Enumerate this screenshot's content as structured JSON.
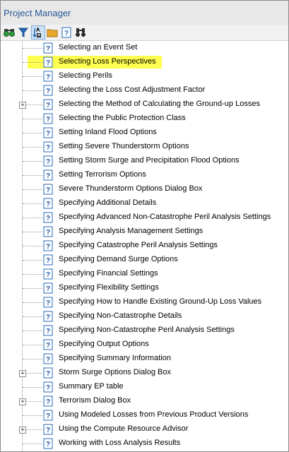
{
  "window": {
    "title": "Project Manager"
  },
  "toolbar": {
    "buttons": [
      {
        "icon": "binoculars-icon"
      },
      {
        "icon": "filter-icon"
      },
      {
        "icon": "sort-az-icon"
      },
      {
        "icon": "folder-icon"
      },
      {
        "icon": "help-topic-icon"
      },
      {
        "icon": "find-icon"
      }
    ]
  },
  "tree": {
    "items": [
      {
        "label": "Selecting an Event Set",
        "expandable": false,
        "selected": false
      },
      {
        "label": "Selecting Loss Perspectives",
        "expandable": false,
        "selected": true
      },
      {
        "label": "Selecting Perils",
        "expandable": false,
        "selected": false
      },
      {
        "label": "Selecting the Loss Cost Adjustment Factor",
        "expandable": false,
        "selected": false
      },
      {
        "label": "Selecting the Method of Calculating the Ground-up Losses",
        "expandable": true,
        "selected": false
      },
      {
        "label": "Selecting the Public Protection Class",
        "expandable": false,
        "selected": false
      },
      {
        "label": "Setting Inland Flood Options",
        "expandable": false,
        "selected": false
      },
      {
        "label": "Setting Severe Thunderstorm Options",
        "expandable": false,
        "selected": false
      },
      {
        "label": "Setting Storm Surge and Precipitation Flood Options",
        "expandable": false,
        "selected": false
      },
      {
        "label": "Setting Terrorism Options",
        "expandable": false,
        "selected": false
      },
      {
        "label": "Severe Thunderstorm Options Dialog Box",
        "expandable": false,
        "selected": false
      },
      {
        "label": "Specifying Additional Details",
        "expandable": false,
        "selected": false
      },
      {
        "label": "Specifying Advanced Non-Catastrophe Peril Analysis Settings",
        "expandable": false,
        "selected": false
      },
      {
        "label": "Specifying Analysis Management Settings",
        "expandable": false,
        "selected": false
      },
      {
        "label": "Specifying Catastrophe Peril Analysis Settings",
        "expandable": false,
        "selected": false
      },
      {
        "label": "Specifying Demand Surge Options",
        "expandable": false,
        "selected": false
      },
      {
        "label": "Specifying Financial Settings",
        "expandable": false,
        "selected": false
      },
      {
        "label": "Specifying Flexibility Settings",
        "expandable": false,
        "selected": false
      },
      {
        "label": "Specifying How to Handle Existing Ground-Up Loss Values",
        "expandable": false,
        "selected": false
      },
      {
        "label": "Specifying Non-Catastrophe Details",
        "expandable": false,
        "selected": false
      },
      {
        "label": "Specifying Non-Catastrophe Peril Analysis Settings",
        "expandable": false,
        "selected": false
      },
      {
        "label": "Specifying Output Options",
        "expandable": false,
        "selected": false
      },
      {
        "label": "Specifying Summary Information",
        "expandable": false,
        "selected": false
      },
      {
        "label": "Storm Surge Options Dialog Box",
        "expandable": true,
        "selected": false
      },
      {
        "label": "Summary EP table",
        "expandable": false,
        "selected": false
      },
      {
        "label": "Terrorism Dialog Box",
        "expandable": true,
        "selected": false
      },
      {
        "label": "Using Modeled Losses from Previous Product Versions",
        "expandable": false,
        "selected": false
      },
      {
        "label": "Using the Compute Resource Advisor",
        "expandable": true,
        "selected": false
      },
      {
        "label": "Working with Loss Analysis Results",
        "expandable": false,
        "selected": false
      }
    ]
  },
  "colors": {
    "selection_highlight": "#ffff4f",
    "title_text": "#2b5a9a",
    "icon_blue": "#2a6ab8"
  }
}
